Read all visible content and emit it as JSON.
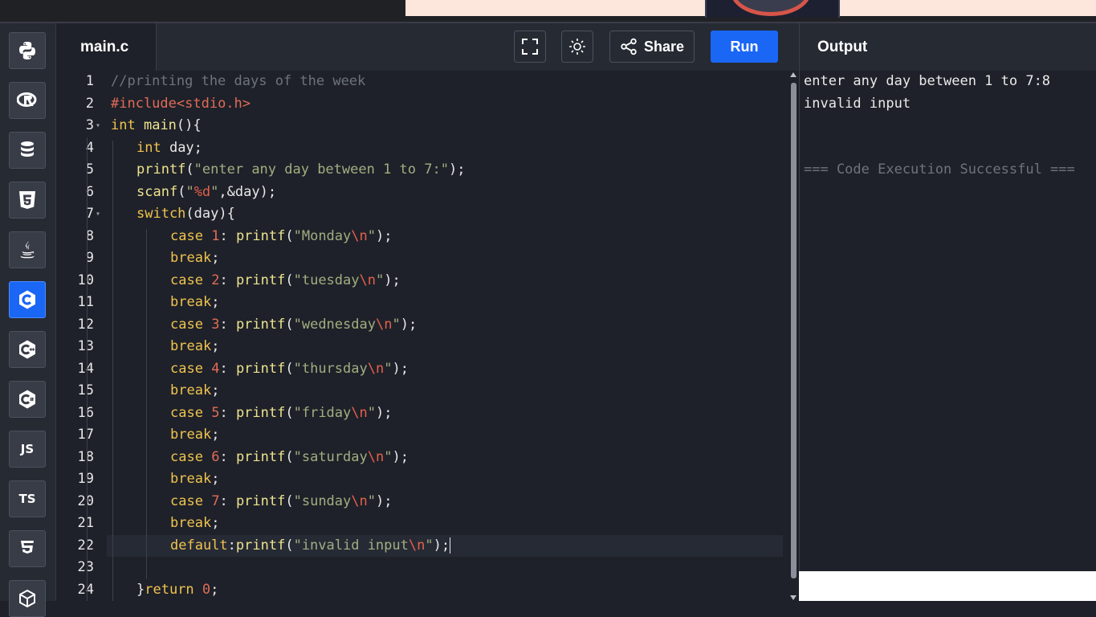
{
  "editor": {
    "filename": "main.c",
    "share_label": "Share",
    "run_label": "Run",
    "lines": [
      {
        "n": "1",
        "fold": "",
        "indent": 0,
        "tokens": [
          {
            "t": "//printing the days of the week",
            "c": "cmt"
          }
        ]
      },
      {
        "n": "2",
        "fold": "",
        "indent": 0,
        "tokens": [
          {
            "t": "#include",
            "c": "pre"
          },
          {
            "t": "<stdio.h>",
            "c": "pre"
          }
        ]
      },
      {
        "n": "3",
        "fold": "▾",
        "indent": 0,
        "tokens": [
          {
            "t": "int",
            "c": "kw"
          },
          {
            "t": " ",
            "c": "plain"
          },
          {
            "t": "main",
            "c": "fn"
          },
          {
            "t": "(){",
            "c": "plain"
          }
        ]
      },
      {
        "n": "4",
        "fold": "",
        "indent": 1,
        "tokens": [
          {
            "t": "int",
            "c": "kw"
          },
          {
            "t": " day;",
            "c": "plain"
          }
        ]
      },
      {
        "n": "5",
        "fold": "",
        "indent": 1,
        "tokens": [
          {
            "t": "printf",
            "c": "fn"
          },
          {
            "t": "(",
            "c": "plain"
          },
          {
            "t": "\"enter any day between 1 to 7:\"",
            "c": "str"
          },
          {
            "t": ");",
            "c": "plain"
          }
        ]
      },
      {
        "n": "6",
        "fold": "",
        "indent": 1,
        "tokens": [
          {
            "t": "scanf",
            "c": "fn"
          },
          {
            "t": "(",
            "c": "plain"
          },
          {
            "t": "\"",
            "c": "str"
          },
          {
            "t": "%d",
            "c": "esc"
          },
          {
            "t": "\"",
            "c": "str"
          },
          {
            "t": ",&day);",
            "c": "plain"
          }
        ]
      },
      {
        "n": "7",
        "fold": "▾",
        "indent": 1,
        "tokens": [
          {
            "t": "switch",
            "c": "kw"
          },
          {
            "t": "(day){",
            "c": "plain"
          }
        ]
      },
      {
        "n": "8",
        "fold": "",
        "indent": 2,
        "tokens": [
          {
            "t": "case",
            "c": "kw"
          },
          {
            "t": " ",
            "c": "plain"
          },
          {
            "t": "1",
            "c": "num"
          },
          {
            "t": ": ",
            "c": "plain"
          },
          {
            "t": "printf",
            "c": "fn"
          },
          {
            "t": "(",
            "c": "plain"
          },
          {
            "t": "\"Monday",
            "c": "str"
          },
          {
            "t": "\\n",
            "c": "esc"
          },
          {
            "t": "\"",
            "c": "str"
          },
          {
            "t": ");",
            "c": "plain"
          }
        ]
      },
      {
        "n": "9",
        "fold": "",
        "indent": 2,
        "tokens": [
          {
            "t": "break",
            "c": "kw"
          },
          {
            "t": ";",
            "c": "plain"
          }
        ]
      },
      {
        "n": "10",
        "fold": "",
        "indent": 2,
        "tokens": [
          {
            "t": "case",
            "c": "kw"
          },
          {
            "t": " ",
            "c": "plain"
          },
          {
            "t": "2",
            "c": "num"
          },
          {
            "t": ": ",
            "c": "plain"
          },
          {
            "t": "printf",
            "c": "fn"
          },
          {
            "t": "(",
            "c": "plain"
          },
          {
            "t": "\"tuesday",
            "c": "str"
          },
          {
            "t": "\\n",
            "c": "esc"
          },
          {
            "t": "\"",
            "c": "str"
          },
          {
            "t": ");",
            "c": "plain"
          }
        ]
      },
      {
        "n": "11",
        "fold": "",
        "indent": 2,
        "tokens": [
          {
            "t": "break",
            "c": "kw"
          },
          {
            "t": ";",
            "c": "plain"
          }
        ]
      },
      {
        "n": "12",
        "fold": "",
        "indent": 2,
        "tokens": [
          {
            "t": "case",
            "c": "kw"
          },
          {
            "t": " ",
            "c": "plain"
          },
          {
            "t": "3",
            "c": "num"
          },
          {
            "t": ": ",
            "c": "plain"
          },
          {
            "t": "printf",
            "c": "fn"
          },
          {
            "t": "(",
            "c": "plain"
          },
          {
            "t": "\"wednesday",
            "c": "str"
          },
          {
            "t": "\\n",
            "c": "esc"
          },
          {
            "t": "\"",
            "c": "str"
          },
          {
            "t": ");",
            "c": "plain"
          }
        ]
      },
      {
        "n": "13",
        "fold": "",
        "indent": 2,
        "tokens": [
          {
            "t": "break",
            "c": "kw"
          },
          {
            "t": ";",
            "c": "plain"
          }
        ]
      },
      {
        "n": "14",
        "fold": "",
        "indent": 2,
        "tokens": [
          {
            "t": "case",
            "c": "kw"
          },
          {
            "t": " ",
            "c": "plain"
          },
          {
            "t": "4",
            "c": "num"
          },
          {
            "t": ": ",
            "c": "plain"
          },
          {
            "t": "printf",
            "c": "fn"
          },
          {
            "t": "(",
            "c": "plain"
          },
          {
            "t": "\"thursday",
            "c": "str"
          },
          {
            "t": "\\n",
            "c": "esc"
          },
          {
            "t": "\"",
            "c": "str"
          },
          {
            "t": ");",
            "c": "plain"
          }
        ]
      },
      {
        "n": "15",
        "fold": "",
        "indent": 2,
        "tokens": [
          {
            "t": "break",
            "c": "kw"
          },
          {
            "t": ";",
            "c": "plain"
          }
        ]
      },
      {
        "n": "16",
        "fold": "",
        "indent": 2,
        "tokens": [
          {
            "t": "case",
            "c": "kw"
          },
          {
            "t": " ",
            "c": "plain"
          },
          {
            "t": "5",
            "c": "num"
          },
          {
            "t": ": ",
            "c": "plain"
          },
          {
            "t": "printf",
            "c": "fn"
          },
          {
            "t": "(",
            "c": "plain"
          },
          {
            "t": "\"friday",
            "c": "str"
          },
          {
            "t": "\\n",
            "c": "esc"
          },
          {
            "t": "\"",
            "c": "str"
          },
          {
            "t": ");",
            "c": "plain"
          }
        ]
      },
      {
        "n": "17",
        "fold": "",
        "indent": 2,
        "tokens": [
          {
            "t": "break",
            "c": "kw"
          },
          {
            "t": ";",
            "c": "plain"
          }
        ]
      },
      {
        "n": "18",
        "fold": "",
        "indent": 2,
        "tokens": [
          {
            "t": "case",
            "c": "kw"
          },
          {
            "t": " ",
            "c": "plain"
          },
          {
            "t": "6",
            "c": "num"
          },
          {
            "t": ": ",
            "c": "plain"
          },
          {
            "t": "printf",
            "c": "fn"
          },
          {
            "t": "(",
            "c": "plain"
          },
          {
            "t": "\"saturday",
            "c": "str"
          },
          {
            "t": "\\n",
            "c": "esc"
          },
          {
            "t": "\"",
            "c": "str"
          },
          {
            "t": ");",
            "c": "plain"
          }
        ]
      },
      {
        "n": "19",
        "fold": "",
        "indent": 2,
        "tokens": [
          {
            "t": "break",
            "c": "kw"
          },
          {
            "t": ";",
            "c": "plain"
          }
        ]
      },
      {
        "n": "20",
        "fold": "",
        "indent": 2,
        "tokens": [
          {
            "t": "case",
            "c": "kw"
          },
          {
            "t": " ",
            "c": "plain"
          },
          {
            "t": "7",
            "c": "num"
          },
          {
            "t": ": ",
            "c": "plain"
          },
          {
            "t": "printf",
            "c": "fn"
          },
          {
            "t": "(",
            "c": "plain"
          },
          {
            "t": "\"sunday",
            "c": "str"
          },
          {
            "t": "\\n",
            "c": "esc"
          },
          {
            "t": "\"",
            "c": "str"
          },
          {
            "t": ");",
            "c": "plain"
          }
        ]
      },
      {
        "n": "21",
        "fold": "",
        "indent": 2,
        "tokens": [
          {
            "t": "break",
            "c": "kw"
          },
          {
            "t": ";",
            "c": "plain"
          }
        ]
      },
      {
        "n": "22",
        "fold": "",
        "indent": 2,
        "active": true,
        "tokens": [
          {
            "t": "default",
            "c": "kw"
          },
          {
            "t": ":",
            "c": "plain"
          },
          {
            "t": "printf",
            "c": "fn"
          },
          {
            "t": "(",
            "c": "plain"
          },
          {
            "t": "\"invalid input",
            "c": "str"
          },
          {
            "t": "\\n",
            "c": "esc"
          },
          {
            "t": "\"",
            "c": "str"
          },
          {
            "t": ");",
            "c": "plain"
          }
        ]
      },
      {
        "n": "23",
        "fold": "",
        "indent": 0,
        "tokens": []
      },
      {
        "n": "24",
        "fold": "",
        "indent": 1,
        "tokens": [
          {
            "t": "}",
            "c": "plain"
          },
          {
            "t": "return",
            "c": "kw"
          },
          {
            "t": " ",
            "c": "plain"
          },
          {
            "t": "0",
            "c": "num"
          },
          {
            "t": ";",
            "c": "plain"
          }
        ]
      }
    ]
  },
  "sidebar": {
    "items": [
      {
        "name": "python",
        "icon": "python-icon",
        "label": ""
      },
      {
        "name": "r",
        "icon": "r-icon",
        "label": ""
      },
      {
        "name": "sql",
        "icon": "database-icon",
        "label": ""
      },
      {
        "name": "html",
        "icon": "html5-icon",
        "label": ""
      },
      {
        "name": "java",
        "icon": "java-icon",
        "label": ""
      },
      {
        "name": "c",
        "icon": "c-icon",
        "label": "",
        "active": true
      },
      {
        "name": "cpp",
        "icon": "cpp-icon",
        "label": ""
      },
      {
        "name": "csharp",
        "icon": "csharp-icon",
        "label": ""
      },
      {
        "name": "javascript",
        "icon": "",
        "label": "JS"
      },
      {
        "name": "typescript",
        "icon": "",
        "label": "TS"
      },
      {
        "name": "css",
        "icon": "css3-icon",
        "label": ""
      },
      {
        "name": "more",
        "icon": "cube-icon",
        "label": ""
      }
    ]
  },
  "output": {
    "title": "Output",
    "lines": [
      {
        "text": "enter any day between 1 to 7:8",
        "kind": "normal"
      },
      {
        "text": "invalid input",
        "kind": "normal"
      },
      {
        "text": "",
        "kind": "normal"
      },
      {
        "text": "",
        "kind": "normal"
      },
      {
        "text": "=== Code Execution Successful ===",
        "kind": "success"
      }
    ]
  },
  "colors": {
    "accent": "#1a66f5",
    "background": "#1e2129",
    "panel": "#262a33",
    "keyword": "#f0c34f",
    "function": "#eee38f",
    "string": "#a2ad80",
    "escape": "#e5604b",
    "comment": "#6d737d"
  }
}
